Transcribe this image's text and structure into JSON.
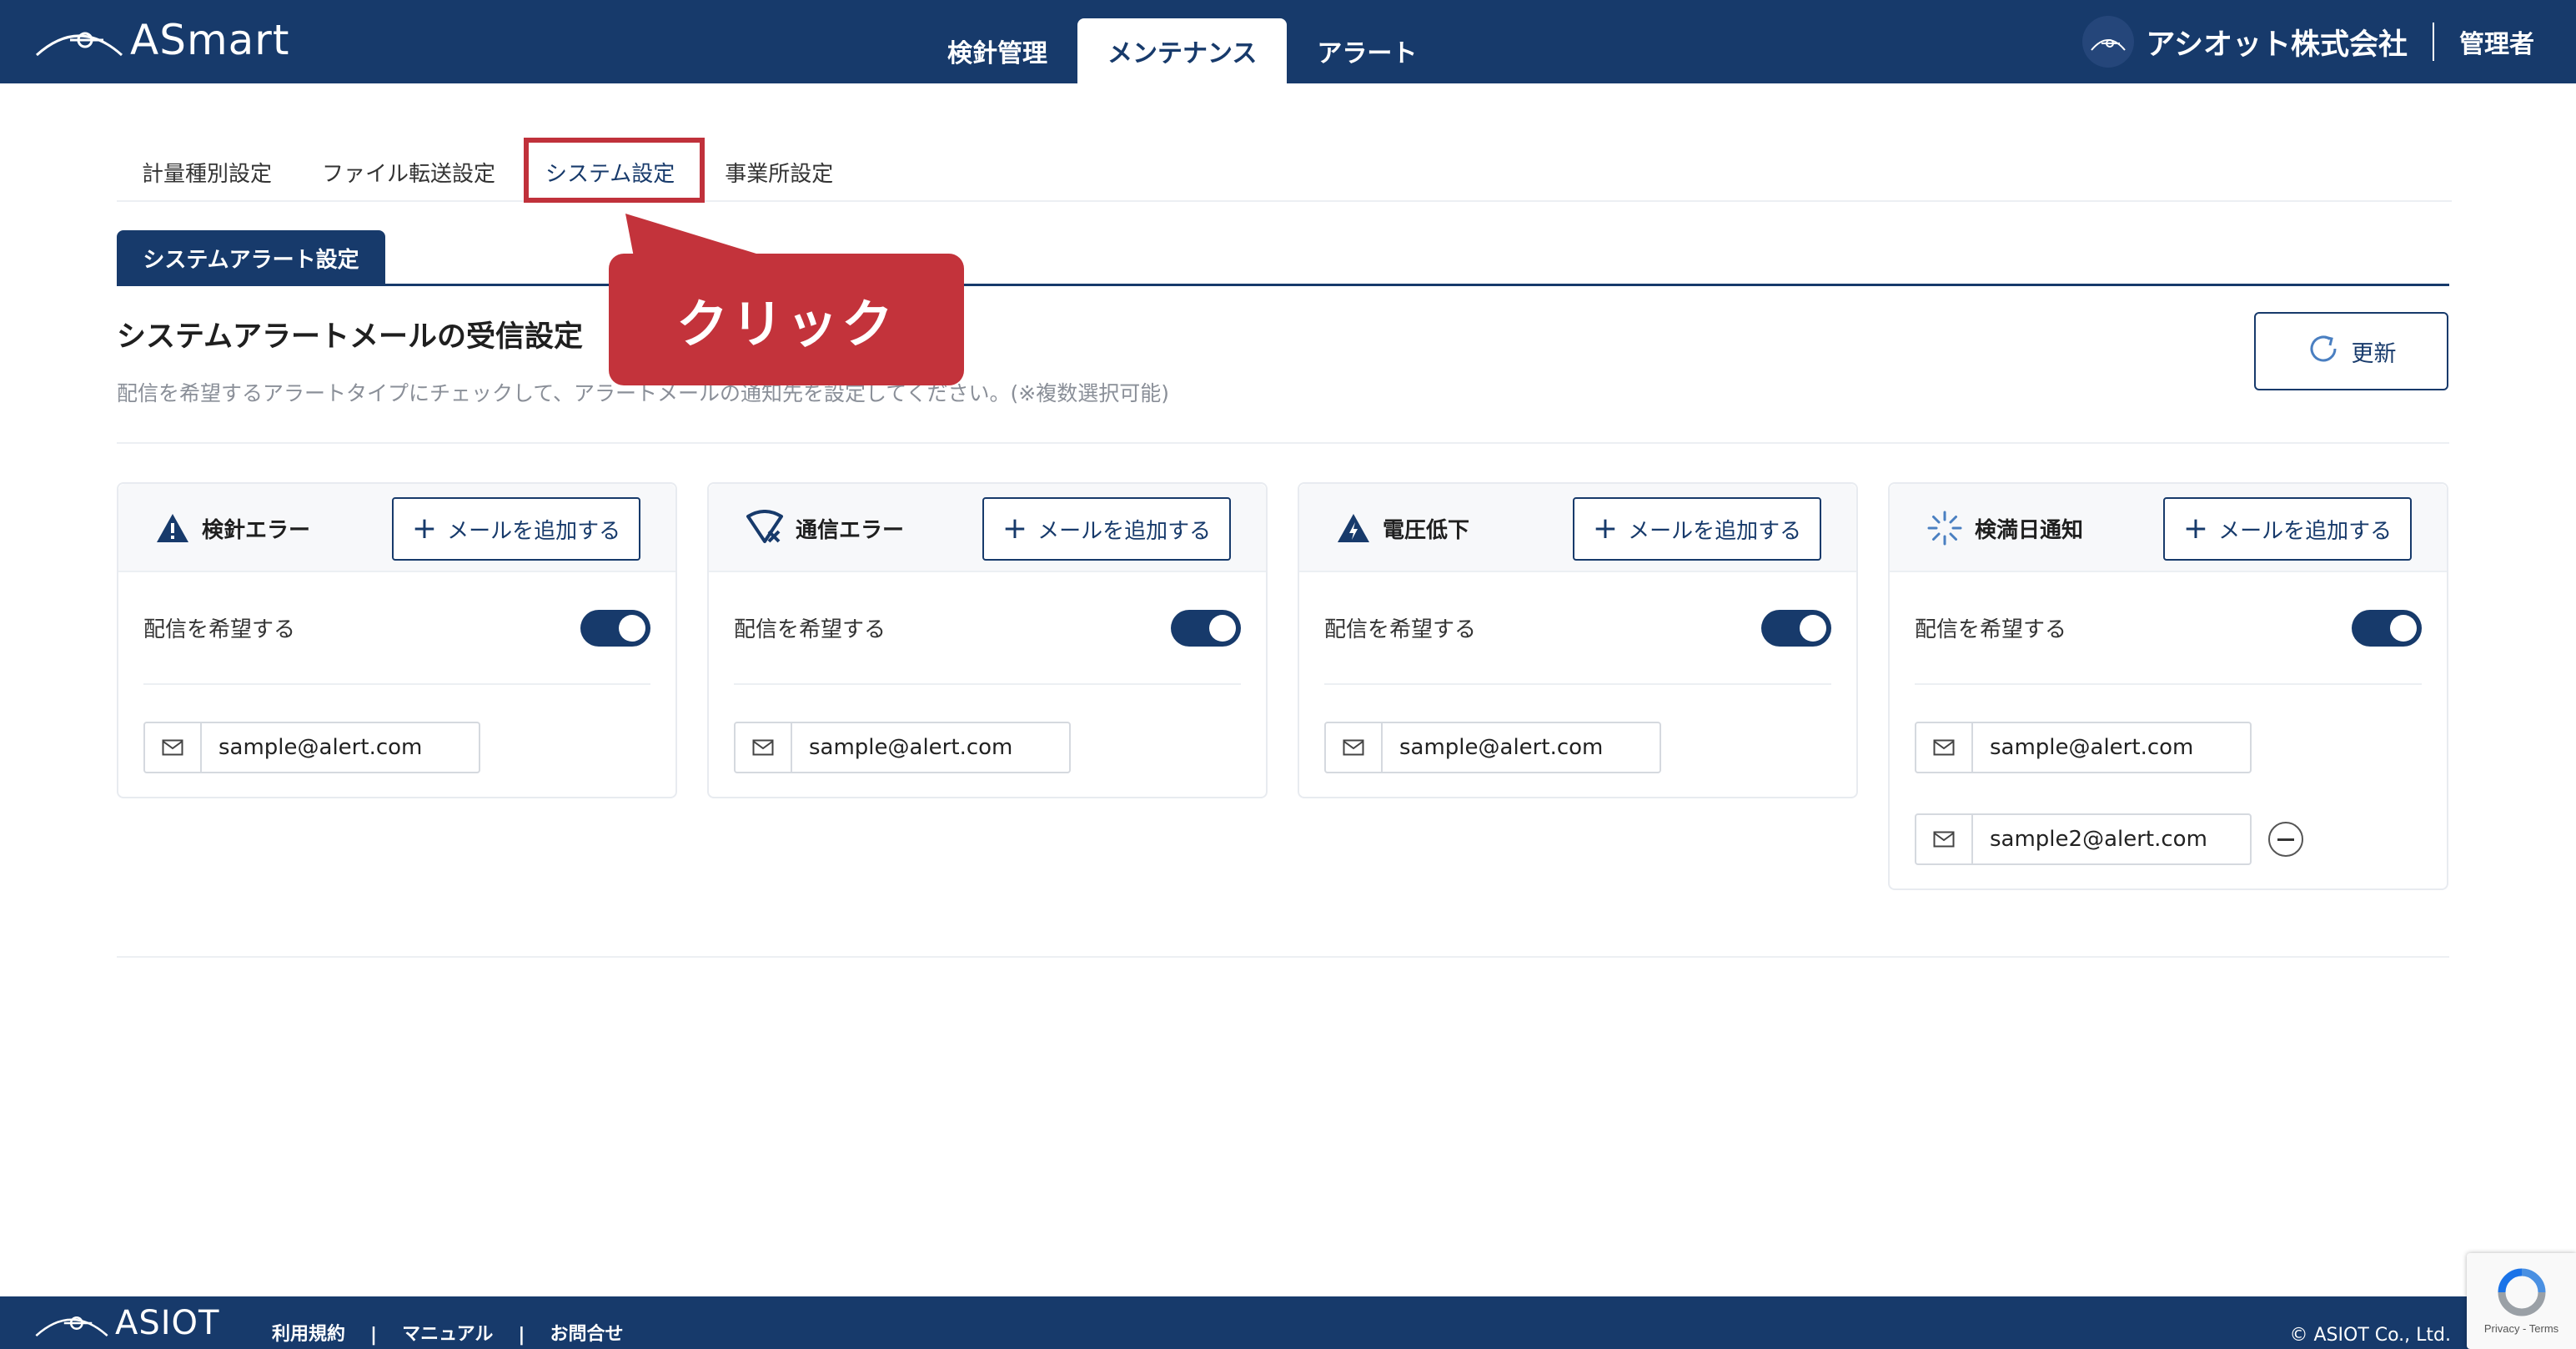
{
  "header": {
    "logo": "ASmart",
    "tabs": [
      {
        "label": "検針管理",
        "active": false
      },
      {
        "label": "メンテナンス",
        "active": true
      },
      {
        "label": "アラート",
        "active": false
      }
    ],
    "company": "アシオット株式会社",
    "role": "管理者"
  },
  "subtabs": [
    {
      "label": "計量種別設定"
    },
    {
      "label": "ファイル転送設定"
    },
    {
      "label": "システム設定",
      "active": true
    },
    {
      "label": "事業所設定"
    }
  ],
  "section_tab": "システムアラート設定",
  "heading": "システムアラートメールの受信設定",
  "description": "配信を希望するアラートタイプにチェックして、アラートメールの通知先を設定してください。(※複数選択可能)",
  "refresh_label": "更新",
  "callout": "クリック",
  "cards": [
    {
      "title": "検針エラー",
      "icon": "warning-icon",
      "add_label": "メールを追加する",
      "toggle_label": "配信を希望する",
      "toggle_on": true,
      "emails": [
        "sample@alert.com"
      ]
    },
    {
      "title": "通信エラー",
      "icon": "signal-error-icon",
      "add_label": "メールを追加する",
      "toggle_label": "配信を希望する",
      "toggle_on": true,
      "emails": [
        "sample@alert.com"
      ]
    },
    {
      "title": "電圧低下",
      "icon": "voltage-warning-icon",
      "add_label": "メールを追加する",
      "toggle_label": "配信を希望する",
      "toggle_on": true,
      "emails": [
        "sample@alert.com"
      ]
    },
    {
      "title": "検満日通知",
      "icon": "loading-icon",
      "add_label": "メールを追加する",
      "toggle_label": "配信を希望する",
      "toggle_on": true,
      "emails": [
        "sample@alert.com",
        "sample2@alert.com"
      ]
    }
  ],
  "footer": {
    "logo": "ASIOT",
    "links": [
      "利用規約",
      "マニュアル",
      "お問合せ"
    ],
    "copyright": "© ASIOT Co., Ltd."
  },
  "recaptcha": "Privacy - Terms",
  "colors": {
    "brand": "#173a6b",
    "callout": "#c3333b"
  }
}
